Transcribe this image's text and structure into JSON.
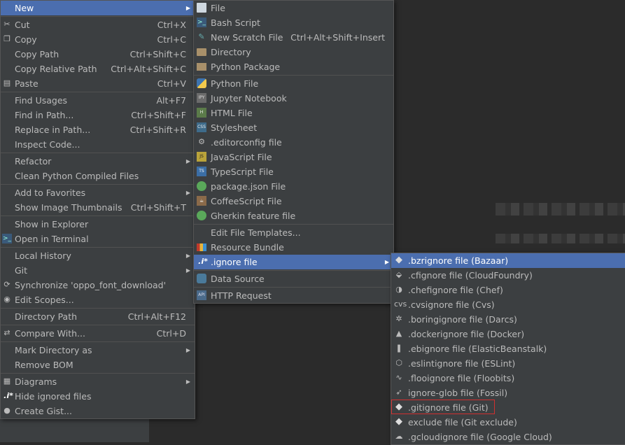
{
  "main_menu": [
    {
      "label": "New",
      "shortcut": "",
      "icon": "",
      "submenu": true,
      "selected": true
    },
    {
      "sep": true
    },
    {
      "label": "Cut",
      "shortcut": "Ctrl+X",
      "icon": "scissors-icon"
    },
    {
      "label": "Copy",
      "shortcut": "Ctrl+C",
      "icon": "copy-icon"
    },
    {
      "label": "Copy Path",
      "shortcut": "Ctrl+Shift+C",
      "icon": ""
    },
    {
      "label": "Copy Relative Path",
      "shortcut": "Ctrl+Alt+Shift+C",
      "icon": ""
    },
    {
      "label": "Paste",
      "shortcut": "Ctrl+V",
      "icon": "paste-icon"
    },
    {
      "sep": true
    },
    {
      "label": "Find Usages",
      "shortcut": "Alt+F7",
      "icon": ""
    },
    {
      "label": "Find in Path...",
      "shortcut": "Ctrl+Shift+F",
      "icon": ""
    },
    {
      "label": "Replace in Path...",
      "shortcut": "Ctrl+Shift+R",
      "icon": ""
    },
    {
      "label": "Inspect Code...",
      "shortcut": "",
      "icon": ""
    },
    {
      "sep": true
    },
    {
      "label": "Refactor",
      "shortcut": "",
      "icon": "",
      "submenu": true
    },
    {
      "label": "Clean Python Compiled Files",
      "shortcut": "",
      "icon": ""
    },
    {
      "sep": true
    },
    {
      "label": "Add to Favorites",
      "shortcut": "",
      "icon": "",
      "submenu": true
    },
    {
      "label": "Show Image Thumbnails",
      "shortcut": "Ctrl+Shift+T",
      "icon": ""
    },
    {
      "sep": true
    },
    {
      "label": "Show in Explorer",
      "shortcut": "",
      "icon": ""
    },
    {
      "label": "Open in Terminal",
      "shortcut": "",
      "icon": "terminal-icon"
    },
    {
      "sep": true
    },
    {
      "label": "Local History",
      "shortcut": "",
      "icon": "",
      "submenu": true
    },
    {
      "label": "Git",
      "shortcut": "",
      "icon": "",
      "submenu": true
    },
    {
      "label": "Synchronize 'oppo_font_download'",
      "shortcut": "",
      "icon": "sync-icon"
    },
    {
      "label": "Edit Scopes...",
      "shortcut": "",
      "icon": "scope-icon"
    },
    {
      "sep": true
    },
    {
      "label": "Directory Path",
      "shortcut": "Ctrl+Alt+F12",
      "icon": ""
    },
    {
      "sep": true
    },
    {
      "label": "Compare With...",
      "shortcut": "Ctrl+D",
      "icon": "compare-icon"
    },
    {
      "sep": true
    },
    {
      "label": "Mark Directory as",
      "shortcut": "",
      "icon": "",
      "submenu": true
    },
    {
      "label": "Remove BOM",
      "shortcut": "",
      "icon": ""
    },
    {
      "sep": true
    },
    {
      "label": "Diagrams",
      "shortcut": "",
      "icon": "diagram-icon",
      "submenu": true
    },
    {
      "label": "Hide ignored files",
      "shortcut": "",
      "icon": "ignore-icon"
    },
    {
      "label": "Create Gist...",
      "shortcut": "",
      "icon": "github-icon"
    }
  ],
  "new_menu": [
    {
      "label": "File",
      "shortcut": "",
      "icon": "file-icon"
    },
    {
      "label": "Bash Script",
      "shortcut": "",
      "icon": "terminal-icon"
    },
    {
      "label": "New Scratch File",
      "shortcut": "Ctrl+Alt+Shift+Insert",
      "icon": "scratch-file-icon"
    },
    {
      "label": "Directory",
      "shortcut": "",
      "icon": "folder-icon"
    },
    {
      "label": "Python Package",
      "shortcut": "",
      "icon": "package-icon"
    },
    {
      "sep": true
    },
    {
      "label": "Python File",
      "shortcut": "",
      "icon": "python-icon"
    },
    {
      "label": "Jupyter Notebook",
      "shortcut": "",
      "icon": "jupyter-icon"
    },
    {
      "label": "HTML File",
      "shortcut": "",
      "icon": "html-icon"
    },
    {
      "label": "Stylesheet",
      "shortcut": "",
      "icon": "css-icon"
    },
    {
      "label": ".editorconfig file",
      "shortcut": "",
      "icon": "editorconfig-icon"
    },
    {
      "label": "JavaScript File",
      "shortcut": "",
      "icon": "js-icon"
    },
    {
      "label": "TypeScript File",
      "shortcut": "",
      "icon": "ts-icon"
    },
    {
      "label": "package.json File",
      "shortcut": "",
      "icon": "nodejs-icon"
    },
    {
      "label": "CoffeeScript File",
      "shortcut": "",
      "icon": "coffee-icon"
    },
    {
      "label": "Gherkin feature file",
      "shortcut": "",
      "icon": "cucumber-icon"
    },
    {
      "sep": true
    },
    {
      "label": "Edit File Templates...",
      "shortcut": "",
      "icon": ""
    },
    {
      "label": "Resource Bundle",
      "shortcut": "",
      "icon": "resource-bundle-icon"
    },
    {
      "label": ".ignore file",
      "shortcut": "",
      "icon": "ignore-file-icon",
      "submenu": true,
      "selected": true
    },
    {
      "sep": true
    },
    {
      "label": "Data Source",
      "shortcut": "",
      "icon": "database-icon"
    },
    {
      "sep": true
    },
    {
      "label": "HTTP Request",
      "shortcut": "",
      "icon": "api-icon"
    }
  ],
  "ignore_menu": [
    {
      "label": ".bzrignore file (Bazaar)",
      "icon": "bazaar-icon",
      "selected": true
    },
    {
      "label": ".cfignore file (CloudFoundry)",
      "icon": "cloudfoundry-icon"
    },
    {
      "label": ".chefignore file (Chef)",
      "icon": "chef-icon"
    },
    {
      "label": ".cvsignore file (Cvs)",
      "icon": "cvs-icon"
    },
    {
      "label": ".boringignore file (Darcs)",
      "icon": "darcs-icon"
    },
    {
      "label": ".dockerignore file (Docker)",
      "icon": "docker-icon"
    },
    {
      "label": ".ebignore file (ElasticBeanstalk)",
      "icon": "elasticbeanstalk-icon"
    },
    {
      "label": ".eslintignore file (ESLint)",
      "icon": "eslint-icon"
    },
    {
      "label": ".flooignore file (Floobits)",
      "icon": "floobits-icon"
    },
    {
      "label": "ignore-glob file (Fossil)",
      "icon": "fossil-icon"
    },
    {
      "label": ".gitignore file (Git)",
      "icon": "git-icon",
      "highlighted": true
    },
    {
      "label": "exclude file (Git exclude)",
      "icon": "git-exclude-icon"
    },
    {
      "label": ".gcloudignore file (Google Cloud)",
      "icon": "google-cloud-icon"
    }
  ],
  "icon_glyphs": {
    "scissors-icon": "✂",
    "copy-icon": "❐",
    "paste-icon": "▤",
    "terminal-icon": ">_",
    "sync-icon": "⟳",
    "scope-icon": "◉",
    "compare-icon": "⇄",
    "diagram-icon": "▦",
    "ignore-icon": ".i*",
    "github-icon": "●",
    "file-icon": "",
    "scratch-file-icon": "✎",
    "folder-icon": "",
    "package-icon": "",
    "python-icon": "",
    "jupyter-icon": "IPY",
    "html-icon": "H",
    "css-icon": "CSS",
    "editorconfig-icon": "⚙",
    "js-icon": "JS",
    "ts-icon": "TS",
    "nodejs-icon": "",
    "coffee-icon": "☕",
    "cucumber-icon": "",
    "resource-bundle-icon": "",
    "ignore-file-icon": ".i*",
    "database-icon": "",
    "api-icon": "API",
    "bazaar-icon": "◆",
    "cloudfoundry-icon": "⬙",
    "chef-icon": "◑",
    "cvs-icon": "cvs",
    "darcs-icon": "✲",
    "docker-icon": "▲",
    "elasticbeanstalk-icon": "❚",
    "eslint-icon": "⬡",
    "floobits-icon": "∿",
    "fossil-icon": "➶",
    "git-icon": "◆",
    "git-exclude-icon": "◆",
    "google-cloud-icon": "☁"
  },
  "icon_classes": {
    "file-icon": "i-file",
    "terminal-icon": "i-term",
    "scratch-file-icon": "i-scratch",
    "folder-icon": "i-folder",
    "package-icon": "i-pkg",
    "python-icon": "i-py",
    "jupyter-icon": "i-jup",
    "html-icon": "i-html",
    "css-icon": "i-css",
    "js-icon": "i-js",
    "ts-icon": "i-ts",
    "nodejs-icon": "i-green",
    "coffee-icon": "i-coffee",
    "cucumber-icon": "i-green",
    "resource-bundle-icon": "i-res",
    "ignore-file-icon": "i-ignore",
    "ignore-icon": "i-ignore",
    "database-icon": "i-db",
    "api-icon": "i-api",
    "bazaar-icon": "i-diamond",
    "git-icon": "i-git",
    "git-exclude-icon": "i-git"
  },
  "colors": {
    "selection": "#4b6eaf",
    "menu_bg": "#3c3f41",
    "highlight_border": "#d03030"
  }
}
